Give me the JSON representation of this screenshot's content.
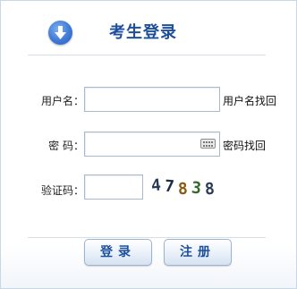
{
  "header": {
    "title": "考生登录",
    "icon": "download-arrow-icon"
  },
  "form": {
    "username": {
      "label": "用户名：",
      "value": "",
      "link": "用户名找回"
    },
    "password": {
      "label": "密 码：",
      "value": "",
      "link": "密码找回",
      "icon": "virtual-keyboard-icon"
    },
    "captcha": {
      "label": "验证码：",
      "value": "",
      "code": "47838"
    }
  },
  "buttons": {
    "login": "登录",
    "register": "注册"
  },
  "colors": {
    "title": "#1d4f9c",
    "accent": "#3f79d6",
    "border": "#a9b8cc"
  }
}
